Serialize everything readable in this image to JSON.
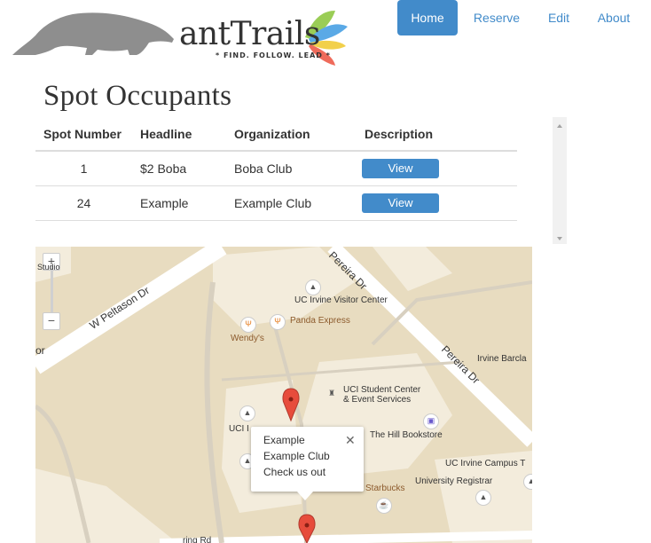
{
  "brand": {
    "name": "antTrails",
    "tagline": "* FIND. FOLLOW. LEAD *"
  },
  "nav": {
    "items": [
      "Home",
      "Reserve",
      "Edit",
      "About"
    ],
    "active": "Home"
  },
  "page_title": "Spot Occupants",
  "table": {
    "headers": [
      "Spot Number",
      "Headline",
      "Organization",
      "Description"
    ],
    "rows": [
      {
        "spot": "1",
        "headline": "$2 Boba",
        "organization": "Boba Club",
        "action": "View"
      },
      {
        "spot": "24",
        "headline": "Example",
        "organization": "Example Club",
        "action": "View"
      }
    ]
  },
  "map": {
    "zoom_in": "+",
    "zoom_out": "−",
    "labels": {
      "w_peltason": "W Peltason Dr",
      "pereira_top": "Pereira Dr",
      "pereira_right": "Pereira Dr",
      "visitor_center": "UC Irvine Visitor Center",
      "panda_express": "Panda Express",
      "wendys": "Wendy's",
      "student_center": "UCI Student Center",
      "event_services": "& Event Services",
      "hill_bookstore": "The Hill Bookstore",
      "irvine_barclay": "Irvine Barcla",
      "campus": "UC Irvine Campus T",
      "university_registrar": "University Registrar",
      "starbucks": "Starbucks",
      "uci_left": "UCI I",
      "studio": "Studio",
      "or_frag": "or",
      "rd_frag": "ring Rd"
    },
    "info_window": {
      "lines": [
        "Example",
        "Example Club",
        "Check us out"
      ],
      "close": "✕"
    }
  },
  "colors": {
    "primary": "#428bca",
    "map_bg": "#e8dcc0",
    "road": "#ffffff"
  }
}
